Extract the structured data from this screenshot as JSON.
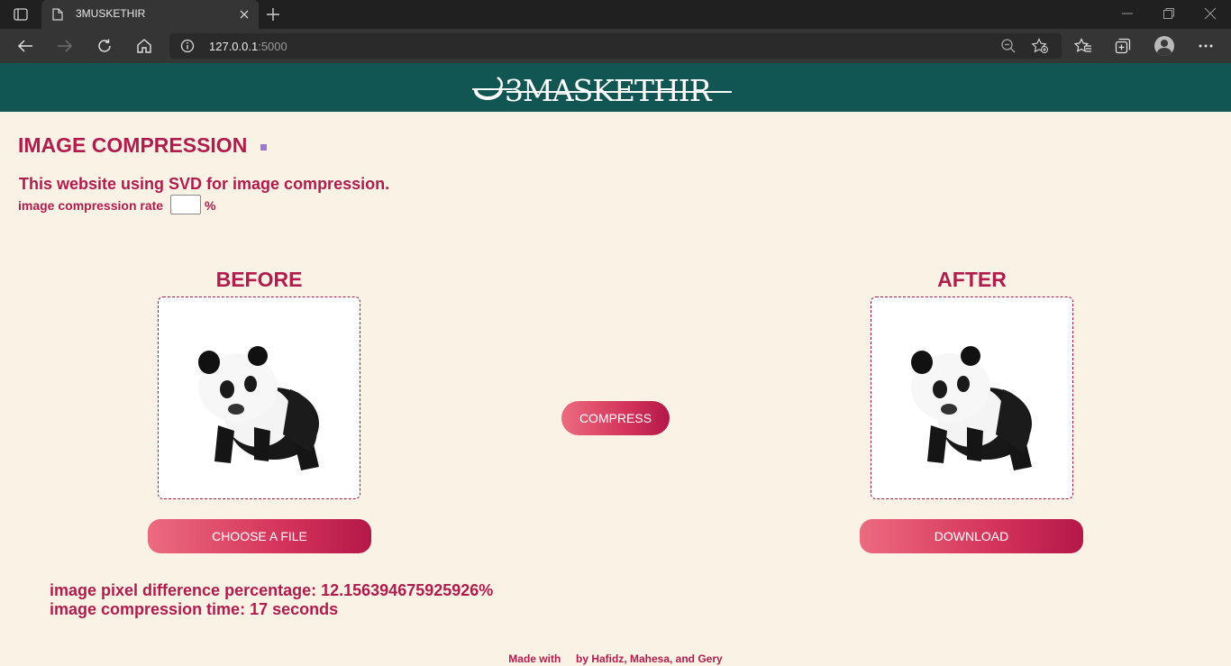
{
  "browser": {
    "tab_title": "3MUSKETHIR",
    "url_host": "127.0.0.1",
    "url_port": ":5000"
  },
  "site": {
    "logo_text": "3MASKETHIR",
    "page_title": "IMAGE COMPRESSION",
    "description": "This website using SVD for image compression.",
    "rate_label": "image compression rate",
    "rate_value": "",
    "rate_unit": "%",
    "before_title": "BEFORE",
    "after_title": "AFTER",
    "compress_label": "COMPRESS",
    "choose_label": "CHOOSE A FILE",
    "download_label": "DOWNLOAD",
    "pixel_diff": "image pixel difference percentage: 12.156394675925926%",
    "compression_time": "image compression time: 17 seconds",
    "footer_made": "Made with",
    "footer_by": "by Hafidz, Mahesa, and Gery"
  },
  "colors": {
    "header_bg": "#125654",
    "page_bg": "#faf2e4",
    "accent": "#b01c4e"
  },
  "icons": [
    "tab-actions-icon",
    "page-icon",
    "close-icon",
    "plus-icon",
    "minimize-icon",
    "restore-icon",
    "window-close-icon",
    "back-icon",
    "forward-icon",
    "refresh-icon",
    "home-icon",
    "info-icon",
    "zoom-out-icon",
    "add-favorite-icon",
    "favorites-icon",
    "collections-icon",
    "profile-icon",
    "more-icon",
    "panda-image",
    "heart-icon"
  ]
}
